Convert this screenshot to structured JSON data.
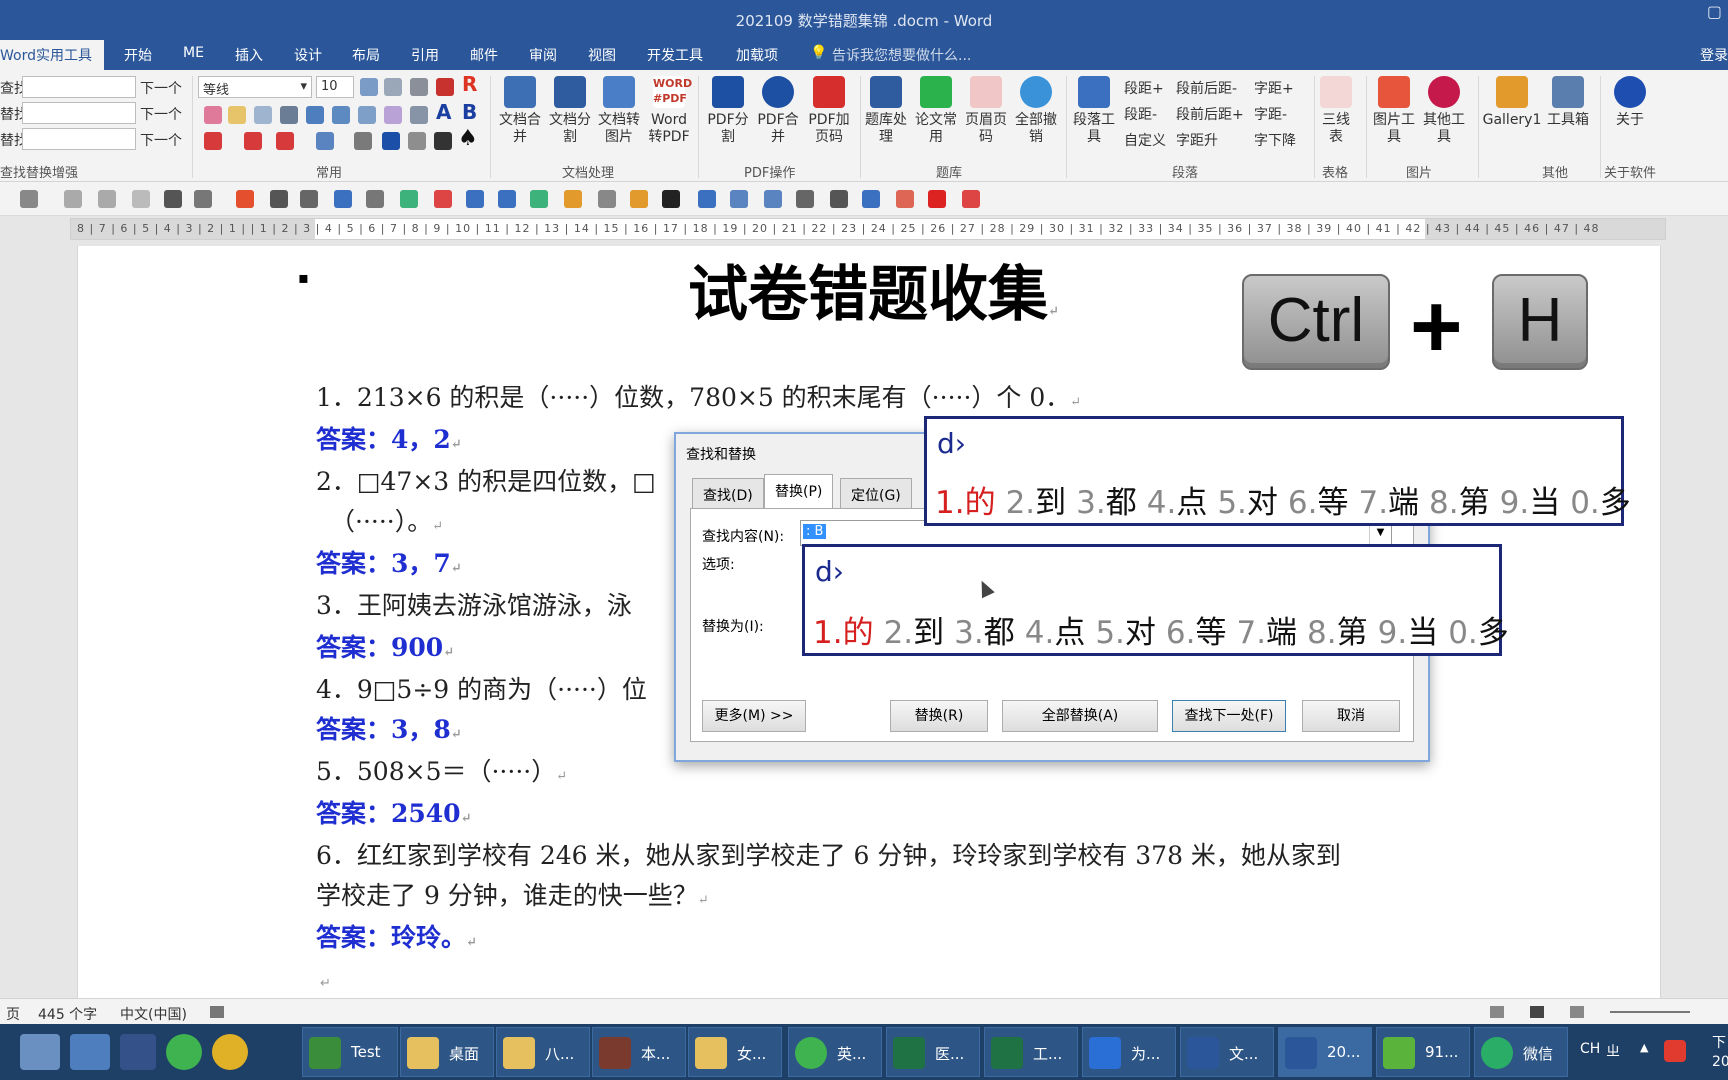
{
  "window": {
    "title": "202109 数学错题集锦 .docm - Word",
    "restore_glyph": "▢"
  },
  "menu": {
    "tabs": [
      "Word实用工具",
      "开始",
      "ME",
      "插入",
      "设计",
      "布局",
      "引用",
      "邮件",
      "审阅",
      "视图",
      "开发工具",
      "加载项"
    ],
    "tell_me": "告诉我您想要做什么...",
    "login": "登录"
  },
  "ribbon": {
    "find_labels": [
      "查找",
      "替找",
      "替找"
    ],
    "next_labels": [
      "下一个",
      "下一个",
      "下一个"
    ],
    "font_name": "等线",
    "font_size": "10",
    "groups": [
      "查找替换增强",
      "常用",
      "文档处理",
      "PDF操作",
      "题库",
      "段落",
      "表格",
      "图片",
      "其他",
      "关于软件"
    ],
    "doc_buttons": [
      "文档合并",
      "文档分割",
      "文档转图片",
      "Word转PDF"
    ],
    "pdf_buttons": [
      "PDF分割",
      "PDF合并",
      "PDF加页码"
    ],
    "tiku_buttons": [
      "题库处理",
      "论文常用",
      "页眉页码",
      "全部撤销"
    ],
    "para_button": "段落工具",
    "para_small": [
      "段距+",
      "段距-",
      "自定义",
      "段前后距-",
      "段前后距+",
      "字距升",
      "字距+",
      "字距-",
      "字下降"
    ],
    "table_button": "三线表",
    "image_buttons": [
      "图片工具",
      "其他工具"
    ],
    "other_buttons": [
      "Gallery1",
      "工具箱"
    ],
    "about_button": "关于",
    "word_pdf_icon_text": "WORD #PDF"
  },
  "ruler": {
    "text": "8 | 7 | 6 | 5 | 4 | 3 | 2 | 1 |   | 1 | 2 | 3 | 4 | 5 | 6 | 7 | 8 | 9 | 10 | 11 | 12 | 13 | 14 | 15 | 16 | 17 | 18 | 19 | 20 | 21 | 22 | 23 | 24 | 25 | 26 | 27 | 28 | 29 | 30 | 31 | 32 | 33 | 34 | 35 | 36 | 37 | 38 | 39 | 40 | 41 | 42 | 43 | 44 | 45 | 46 | 47 | 48"
  },
  "document": {
    "bullet": "▪",
    "title": "试卷错题收集",
    "para_mark": "↵",
    "lines": [
      {
        "text": "1．213×6 的积是（·····）位数，780×5 的积末尾有（·····）个 0．",
        "answer": false
      },
      {
        "text": "答案：4，2",
        "answer": true
      },
      {
        "text": "2．□47×3 的积是四位数，□",
        "answer": false
      },
      {
        "text": "（·····）。",
        "answer": false
      },
      {
        "text": "答案：3，7",
        "answer": true
      },
      {
        "text": "3．王阿姨去游泳馆游泳，泳",
        "answer": false
      },
      {
        "text": "答案：900",
        "answer": true
      },
      {
        "text": "4．9□5÷9 的商为（·····）位",
        "answer": false
      },
      {
        "text": "答案：3，8",
        "answer": true
      },
      {
        "text": "5．508×5＝（·····）",
        "answer": false
      },
      {
        "text": "答案：2540",
        "answer": true
      },
      {
        "text": "6．红红家到学校有 246 米，她从家到学校走了 6 分钟，玲玲家到学校有 378 米，她从家到",
        "answer": false
      },
      {
        "text": "学校走了 9 分钟，谁走的快一些？",
        "answer": false
      },
      {
        "text": "答案：玲玲。",
        "answer": true
      }
    ]
  },
  "keycaps": {
    "ctrl": "Ctrl",
    "plus": "+",
    "h": "H"
  },
  "dialog": {
    "title": "查找和替换",
    "tabs": [
      "查找(D)",
      "替换(P)",
      "定位(G)"
    ],
    "find_label": "查找内容(N):",
    "find_value": ": B",
    "options_label": "选项:",
    "replace_label": "替换为(I):",
    "buttons": {
      "more": "更多(M) >>",
      "replace": "替换(R)",
      "replace_all": "全部替换(A)",
      "find_next": "查找下一处(F)",
      "cancel": "取消"
    }
  },
  "ime": {
    "code": "d›",
    "candidates": [
      {
        "n": "1.",
        "w": "的"
      },
      {
        "n": "2.",
        "w": "到"
      },
      {
        "n": "3.",
        "w": "都"
      },
      {
        "n": "4.",
        "w": "点"
      },
      {
        "n": "5.",
        "w": "对"
      },
      {
        "n": "6.",
        "w": "等"
      },
      {
        "n": "7.",
        "w": "端"
      },
      {
        "n": "8.",
        "w": "第"
      },
      {
        "n": "9.",
        "w": "当"
      },
      {
        "n": "0.",
        "w": "多"
      }
    ]
  },
  "status": {
    "page": "页",
    "words": "445 个字",
    "lang": "中文(中国)"
  },
  "taskbar": {
    "items": [
      "Test",
      "桌面",
      "八...",
      "本...",
      "女...",
      "英...",
      "医...",
      "工...",
      "为...",
      "文...",
      "20...",
      "91...",
      "微信"
    ],
    "tray": {
      "ime": "CH",
      "ime2": "ㄓ",
      "up": "▲",
      "clock": "下"
    },
    "clock_year": "20"
  },
  "colors": {
    "brand": "#2b579a",
    "answer": "#1f2ed1",
    "ime_border": "#1c2777",
    "ime_first": "#d62020"
  }
}
